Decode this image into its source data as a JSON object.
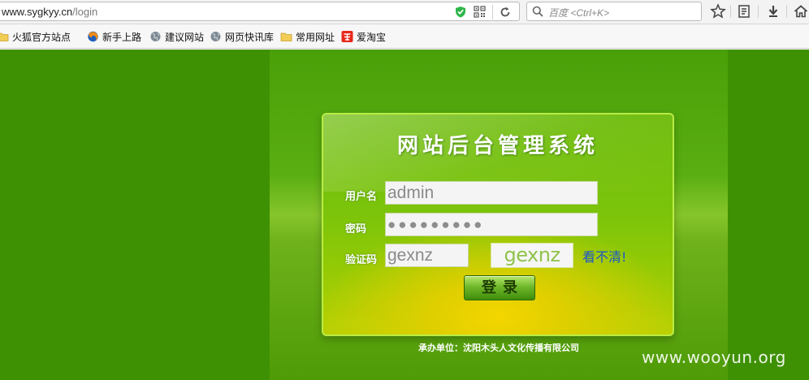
{
  "browser": {
    "url_main": "www.sygkyy.cn",
    "url_path": "/login",
    "search_placeholder": "百度 <Ctrl+K>"
  },
  "bookmarks": [
    {
      "label": "火狐官方站点",
      "icon": "folder-icon"
    },
    {
      "label": "新手上路",
      "icon": "firefox-icon"
    },
    {
      "label": "建议网站",
      "icon": "globe-icon"
    },
    {
      "label": "网页快讯库",
      "icon": "globe-icon"
    },
    {
      "label": "常用网址",
      "icon": "folder-icon"
    },
    {
      "label": "爱淘宝",
      "icon": "taobao-icon"
    }
  ],
  "login": {
    "title": "网站后台管理系统",
    "username_label": "用户名",
    "username_value": "admin",
    "password_label": "密码",
    "password_value": "●●●●●●●●●",
    "captcha_label": "验证码",
    "captcha_value": "gexnz",
    "captcha_image_text": "gexnz",
    "refresh_link": "看不清!",
    "submit_label": "登录"
  },
  "footer": {
    "text": "承办单位：沈阳木头人文化传播有限公司"
  },
  "watermark": "www.wooyun.org",
  "colors": {
    "page_bg": "#3f9104",
    "panel_border": "#b9ec44",
    "link": "#1a55c9"
  }
}
